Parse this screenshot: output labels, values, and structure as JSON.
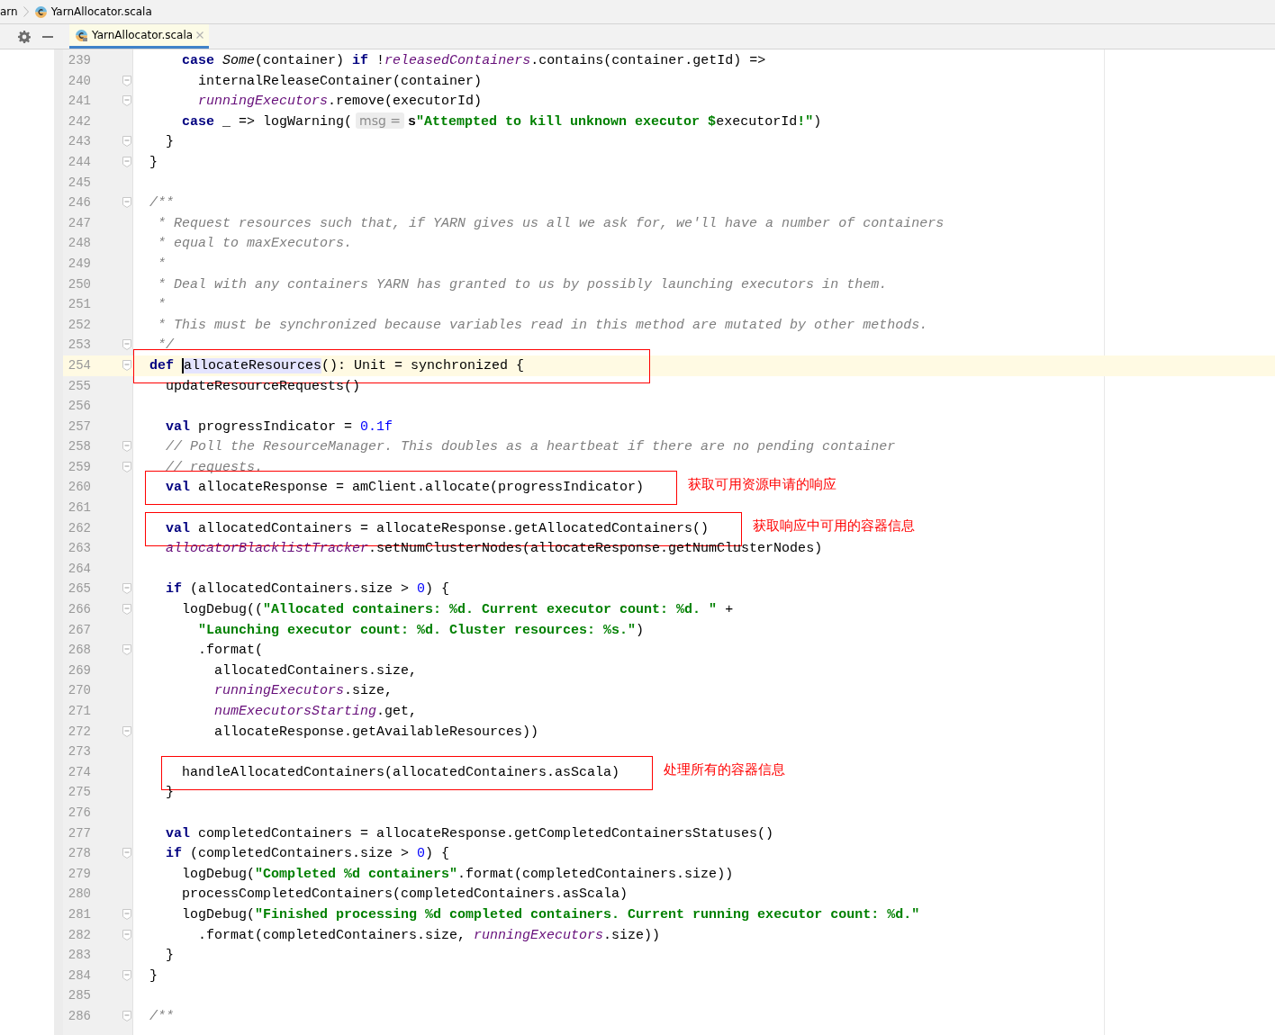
{
  "breadcrumb": [
    "arn",
    "YarnAllocator.scala"
  ],
  "tabs": [
    {
      "label": "YarnAllocator.scala",
      "selected": true
    }
  ],
  "lines": [
    {
      "number": "239",
      "tokens": [
        {
          "kind": "keyword",
          "text": "      case "
        },
        {
          "kind": "italic",
          "text": "Some"
        },
        {
          "kind": "plain",
          "text": "(container) "
        },
        {
          "kind": "keyword",
          "text": "if"
        },
        {
          "kind": "plain",
          "text": " !"
        },
        {
          "kind": "field",
          "text": "releasedContainers"
        },
        {
          "kind": "plain",
          "text": ".contains(container.getId) =>"
        }
      ]
    },
    {
      "number": "240",
      "fold": true,
      "tokens": [
        {
          "kind": "plain",
          "text": "        internalReleaseContainer(container)"
        }
      ]
    },
    {
      "number": "241",
      "fold": true,
      "tokens": [
        {
          "kind": "field",
          "text": "        runningExecutors"
        },
        {
          "kind": "plain",
          "text": ".remove(executorId)"
        }
      ]
    },
    {
      "number": "242",
      "tokens": [
        {
          "kind": "keyword",
          "text": "      case"
        },
        {
          "kind": "plain",
          "text": " _ => logWarning("
        },
        {
          "kind": "hint",
          "text": "msg ="
        },
        {
          "kind": "bold",
          "text": "s"
        },
        {
          "kind": "string",
          "text": "\"Attempted to kill unknown executor $"
        },
        {
          "kind": "plain",
          "text": "executorId"
        },
        {
          "kind": "string",
          "text": "!\""
        },
        {
          "kind": "plain",
          "text": ")"
        }
      ]
    },
    {
      "number": "243",
      "fold": true,
      "tokens": [
        {
          "kind": "plain",
          "text": "    }"
        }
      ]
    },
    {
      "number": "244",
      "fold": true,
      "tokens": [
        {
          "kind": "plain",
          "text": "  }"
        }
      ]
    },
    {
      "number": "245"
    },
    {
      "number": "246",
      "fold": true,
      "tokens": [
        {
          "kind": "comment",
          "text": "  /**"
        }
      ]
    },
    {
      "number": "247",
      "tokens": [
        {
          "kind": "comment",
          "text": "   * Request resources such that, if YARN gives us all we ask for, we'll have a number of containers"
        }
      ]
    },
    {
      "number": "248",
      "tokens": [
        {
          "kind": "comment",
          "text": "   * equal to maxExecutors."
        }
      ]
    },
    {
      "number": "249",
      "tokens": [
        {
          "kind": "comment",
          "text": "   *"
        }
      ]
    },
    {
      "number": "250",
      "tokens": [
        {
          "kind": "comment",
          "text": "   * Deal with any containers YARN has granted to us by possibly launching executors in them."
        }
      ]
    },
    {
      "number": "251",
      "tokens": [
        {
          "kind": "comment",
          "text": "   *"
        }
      ]
    },
    {
      "number": "252",
      "tokens": [
        {
          "kind": "comment",
          "text": "   * This must be synchronized because variables read in this method are mutated by other methods."
        }
      ]
    },
    {
      "number": "253",
      "fold": true,
      "tokens": [
        {
          "kind": "comment",
          "text": "   */"
        }
      ]
    },
    {
      "number": "254",
      "fold": true,
      "current": true,
      "boxed": true,
      "tokens": [
        {
          "kind": "keyword",
          "text": "  def "
        },
        {
          "kind": "selected",
          "text": "allocateResources"
        },
        {
          "kind": "plain",
          "text": "(): Unit = synchronized {"
        }
      ]
    },
    {
      "number": "255",
      "tokens": [
        {
          "kind": "plain",
          "text": "    updateResourceRequests()"
        }
      ]
    },
    {
      "number": "256"
    },
    {
      "number": "257",
      "tokens": [
        {
          "kind": "keyword",
          "text": "    val"
        },
        {
          "kind": "plain",
          "text": " progressIndicator = "
        },
        {
          "kind": "number",
          "text": "0.1f"
        }
      ]
    },
    {
      "number": "258",
      "fold": true,
      "tokens": [
        {
          "kind": "comment",
          "text": "    // Poll the ResourceManager. This doubles as a heartbeat if there are no pending container"
        }
      ]
    },
    {
      "number": "259",
      "fold": true,
      "tokens": [
        {
          "kind": "comment",
          "text": "    // requests."
        }
      ]
    },
    {
      "number": "260",
      "boxed": true,
      "note": "获取可用资源申请的响应",
      "tokens": [
        {
          "kind": "keyword",
          "text": "    val"
        },
        {
          "kind": "plain",
          "text": " allocateResponse = amClient.allocate(progressIndicator)"
        }
      ]
    },
    {
      "number": "261"
    },
    {
      "number": "262",
      "boxed": true,
      "note": "获取响应中可用的容器信息",
      "tokens": [
        {
          "kind": "keyword",
          "text": "    val"
        },
        {
          "kind": "plain",
          "text": " allocatedContainers = allocateResponse.getAllocatedContainers()"
        }
      ]
    },
    {
      "number": "263",
      "tokens": [
        {
          "kind": "field",
          "text": "    allocatorBlacklistTracker"
        },
        {
          "kind": "plain",
          "text": ".setNumClusterNodes(allocateResponse.getNumClusterNodes)"
        }
      ]
    },
    {
      "number": "264"
    },
    {
      "number": "265",
      "fold": true,
      "tokens": [
        {
          "kind": "keyword",
          "text": "    if"
        },
        {
          "kind": "plain",
          "text": " (allocatedContainers.size > "
        },
        {
          "kind": "number",
          "text": "0"
        },
        {
          "kind": "plain",
          "text": ") {"
        }
      ]
    },
    {
      "number": "266",
      "fold": true,
      "tokens": [
        {
          "kind": "plain",
          "text": "      logDebug(("
        },
        {
          "kind": "string",
          "text": "\"Allocated containers: %d. Current executor count: %d. \""
        },
        {
          "kind": "plain",
          "text": " +"
        }
      ]
    },
    {
      "number": "267",
      "tokens": [
        {
          "kind": "string",
          "text": "        \"Launching executor count: %d. Cluster resources: %s.\""
        },
        {
          "kind": "plain",
          "text": ")"
        }
      ]
    },
    {
      "number": "268",
      "fold": true,
      "tokens": [
        {
          "kind": "plain",
          "text": "        .format("
        }
      ]
    },
    {
      "number": "269",
      "tokens": [
        {
          "kind": "plain",
          "text": "          allocatedContainers.size,"
        }
      ]
    },
    {
      "number": "270",
      "tokens": [
        {
          "kind": "field",
          "text": "          runningExecutors"
        },
        {
          "kind": "plain",
          "text": ".size,"
        }
      ]
    },
    {
      "number": "271",
      "tokens": [
        {
          "kind": "field",
          "text": "          numExecutorsStarting"
        },
        {
          "kind": "plain",
          "text": ".get,"
        }
      ]
    },
    {
      "number": "272",
      "fold": true,
      "tokens": [
        {
          "kind": "plain",
          "text": "          allocateResponse.getAvailableResources))"
        }
      ]
    },
    {
      "number": "273"
    },
    {
      "number": "274",
      "boxed": true,
      "note": "处理所有的容器信息",
      "tokens": [
        {
          "kind": "plain",
          "text": "      handleAllocatedContainers(allocatedContainers.asScala)"
        }
      ]
    },
    {
      "number": "275",
      "tokens": [
        {
          "kind": "plain",
          "text": "    }"
        }
      ]
    },
    {
      "number": "276"
    },
    {
      "number": "277",
      "tokens": [
        {
          "kind": "keyword",
          "text": "    val"
        },
        {
          "kind": "plain",
          "text": " completedContainers = allocateResponse.getCompletedContainersStatuses()"
        }
      ]
    },
    {
      "number": "278",
      "fold": true,
      "tokens": [
        {
          "kind": "keyword",
          "text": "    if"
        },
        {
          "kind": "plain",
          "text": " (completedContainers.size > "
        },
        {
          "kind": "number",
          "text": "0"
        },
        {
          "kind": "plain",
          "text": ") {"
        }
      ]
    },
    {
      "number": "279",
      "tokens": [
        {
          "kind": "plain",
          "text": "      logDebug("
        },
        {
          "kind": "string",
          "text": "\"Completed %d containers\""
        },
        {
          "kind": "plain",
          "text": ".format(completedContainers.size))"
        }
      ]
    },
    {
      "number": "280",
      "tokens": [
        {
          "kind": "plain",
          "text": "      processCompletedContainers(completedContainers.asScala)"
        }
      ]
    },
    {
      "number": "281",
      "fold": true,
      "tokens": [
        {
          "kind": "plain",
          "text": "      logDebug("
        },
        {
          "kind": "string",
          "text": "\"Finished processing %d completed containers. Current running executor count: %d.\""
        }
      ]
    },
    {
      "number": "282",
      "fold": true,
      "tokens": [
        {
          "kind": "plain",
          "text": "        .format(completedContainers.size, "
        },
        {
          "kind": "field",
          "text": "runningExecutors"
        },
        {
          "kind": "plain",
          "text": ".size))"
        }
      ]
    },
    {
      "number": "283",
      "tokens": [
        {
          "kind": "plain",
          "text": "    }"
        }
      ]
    },
    {
      "number": "284",
      "fold": true,
      "tokens": [
        {
          "kind": "plain",
          "text": "  }"
        }
      ]
    },
    {
      "number": "285"
    },
    {
      "number": "286",
      "fold": true,
      "tokens": [
        {
          "kind": "comment",
          "text": "  /**"
        }
      ]
    }
  ]
}
